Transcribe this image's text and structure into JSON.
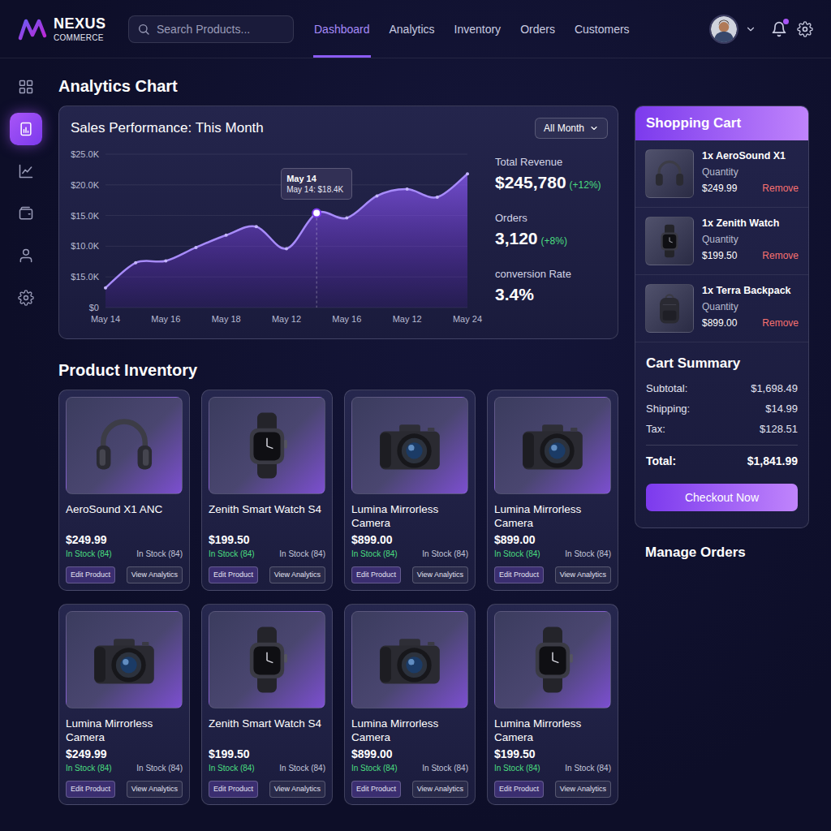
{
  "brand": {
    "name": "NEXUS",
    "tagline": "COMMERCE"
  },
  "search": {
    "placeholder": "Search Products..."
  },
  "nav": [
    {
      "label": "Dashboard",
      "selected": true
    },
    {
      "label": "Analytics",
      "selected": false
    },
    {
      "label": "Inventory",
      "selected": false
    },
    {
      "label": "Orders",
      "selected": false
    },
    {
      "label": "Customers",
      "selected": false
    }
  ],
  "user": {
    "notification": true
  },
  "sidebar": {
    "items": [
      {
        "kind": "grid",
        "selected": false
      },
      {
        "kind": "report",
        "selected": true
      },
      {
        "kind": "trend",
        "selected": false
      },
      {
        "kind": "wallet",
        "selected": false
      },
      {
        "kind": "user",
        "selected": false
      },
      {
        "kind": "settings",
        "selected": false
      }
    ]
  },
  "analytics": {
    "heading": "Analytics Chart",
    "title": "Sales Performance: This Month",
    "period": "All Month",
    "y_ticks": [
      "$25.0K",
      "$20.0K",
      "$15.0K",
      "$10.0K",
      "$15.0K",
      "$0"
    ],
    "x_ticks": [
      "May 14",
      "May 16",
      "May 18",
      "May 12",
      "May 16",
      "May 12",
      "May 24"
    ],
    "series": [
      {
        "name": "Sales",
        "values": [
          3.2,
          7.3,
          7.6,
          9.8,
          11.8,
          13.2,
          9.6,
          15.4,
          14.6,
          18.2,
          19.3,
          18.0,
          21.8
        ]
      }
    ],
    "tooltip": {
      "title": "May 14",
      "text": "May 14: $18.4K",
      "index": 7
    },
    "stats": [
      {
        "label": "Total Revenue",
        "value": "$245,780",
        "change": "(+12%)"
      },
      {
        "label": "Orders",
        "value": "3,120",
        "change": "(+8%)"
      },
      {
        "label": "conversion Rate",
        "value": "3.4%"
      }
    ]
  },
  "inventory": {
    "heading": "Product Inventory",
    "actions": [
      "Edit Product",
      "View Analytics"
    ],
    "products": [
      {
        "name": "AeroSound X1 ANC",
        "price": "$249.99",
        "stock": "In Stock (84)",
        "stock_note": "In Stock (84)",
        "kind": "headphones"
      },
      {
        "name": "Zenith Smart Watch S4",
        "price": "$199.50",
        "stock": "In Stock (84)",
        "stock_note": "In Stock (84)",
        "kind": "watch"
      },
      {
        "name": "Lumina Mirrorless Camera",
        "price": "$899.00",
        "stock": "In Stock (84)",
        "stock_note": "In Stock (84)",
        "kind": "camera"
      },
      {
        "name": "Lumina Mirrorless Camera",
        "price": "$899.00",
        "stock": "In Stock (84)",
        "stock_note": "In Stock (84)",
        "kind": "camera"
      },
      {
        "name": "Lumina Mirrorless Camera",
        "price": "$249.99",
        "stock": "In Stock (84)",
        "stock_note": "In Stock (84)",
        "kind": "camera"
      },
      {
        "name": "Zenith Smart Watch S4",
        "price": "$199.50",
        "stock": "In Stock (84)",
        "stock_note": "In Stock (84)",
        "kind": "watch"
      },
      {
        "name": "Lumina Mirrorless Camera",
        "price": "$899.00",
        "stock": "In Stock (84)",
        "stock_note": "In Stock (84)",
        "kind": "camera"
      },
      {
        "name": "Lumina Mirrorless Camera",
        "price": "$199.50",
        "stock": "In Stock (84)",
        "stock_note": "In Stock (84)",
        "kind": "watch"
      }
    ]
  },
  "cart": {
    "title": "Shopping Cart",
    "items": [
      {
        "name": "1x AeroSound X1",
        "quantity_label": "Quantity",
        "price": "$249.99",
        "action": "Remove",
        "kind": "headphones"
      },
      {
        "name": "1x Zenith Watch",
        "quantity_label": "Quantity",
        "price": "$199.50",
        "action": "Remove",
        "kind": "watch"
      },
      {
        "name": "1x Terra Backpack",
        "quantity_label": "Quantity",
        "price": "$899.00",
        "action": "Remove",
        "kind": "backpack"
      }
    ],
    "summary": {
      "title": "Cart Summary",
      "rows": [
        {
          "label": "Subtotal:",
          "value": "$1,698.49"
        },
        {
          "label": "Shipping:",
          "value": "$14.99"
        },
        {
          "label": "Tax:",
          "value": "$128.51"
        }
      ],
      "total": {
        "label": "Total:",
        "value": "$1,841.99"
      },
      "button": "Checkout Now"
    }
  },
  "orders": {
    "heading": "Manage Orders"
  }
}
